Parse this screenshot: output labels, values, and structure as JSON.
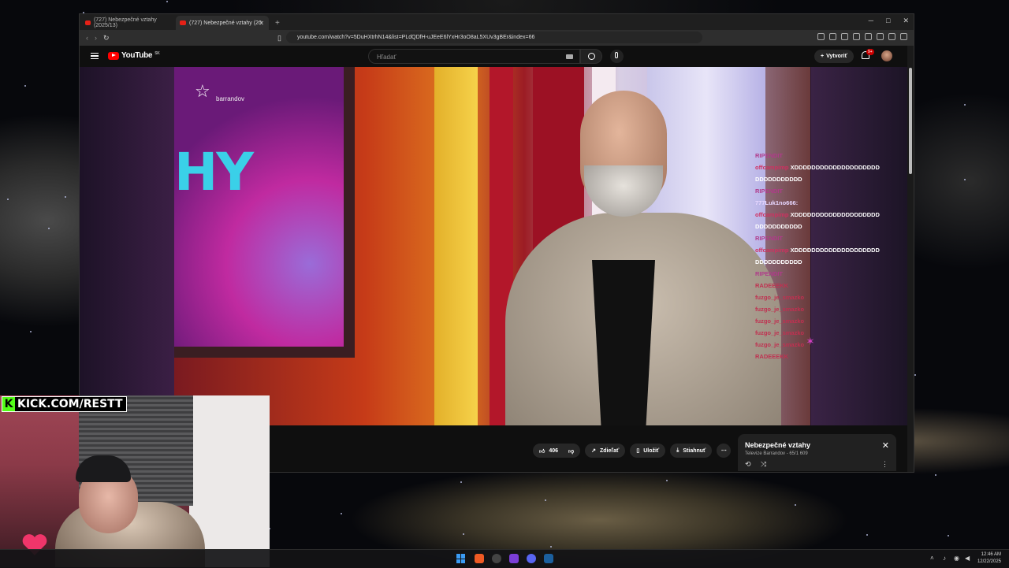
{
  "browser": {
    "tabs": [
      {
        "label": "(727) Nebezpečné vztahy (2025/13)",
        "active": false
      },
      {
        "label": "(727) Nebezpečné vztahy (20",
        "active": true
      }
    ],
    "new_tab": "+",
    "url": "youtube.com/watch?v=5DuHXtrhN14&list=PLdQDfH-uJEeE6lYxHr3oO8aL5XUv3gBEr&index=66"
  },
  "youtube": {
    "logo": "YouTube",
    "region": "SK",
    "search_placeholder": "Hľadať",
    "create_label": "Vytvoriť",
    "notif_count": "9+"
  },
  "video": {
    "brand": "barrandov",
    "graphic_text": "HY"
  },
  "chat": [
    {
      "name": "RIPENDIT",
      "msg": "",
      "color": "#b03a8a"
    },
    {
      "name": "offcampimp",
      "msg": "XDDDDDDDDDDDDDDDDDDDD DDDDDDDDDDD",
      "color": "#d03060"
    },
    {
      "name": "RIPENDIT",
      "msg": "",
      "color": "#b03a8a"
    },
    {
      "name": "777Luk1no666:",
      "msg": "",
      "color": "#e8d7ff"
    },
    {
      "name": "offcampimp",
      "msg": "XDDDDDDDDDDDDDDDDDDDD DDDDDDDDDDD",
      "color": "#d03060"
    },
    {
      "name": "RIPENDIT",
      "msg": "",
      "color": "#b03a8a"
    },
    {
      "name": "offcampimp",
      "msg": "XDDDDDDDDDDDDDDDDDDDD DDDDDDDDDDD",
      "color": "#d03060"
    },
    {
      "name": "RIPENDIT",
      "msg": "",
      "color": "#b03a8a"
    },
    {
      "name": "RADEEEKK",
      "msg": "",
      "color": "#c03050"
    },
    {
      "name": "fuzgo_je_smazko",
      "msg": "",
      "color": "#c03050"
    },
    {
      "name": "fuzgo_je_smazko",
      "msg": "",
      "color": "#c03050"
    },
    {
      "name": "fuzgo_je_smazko",
      "msg": "",
      "color": "#c03050"
    },
    {
      "name": "fuzgo_je_smazko",
      "msg": "",
      "color": "#c03050"
    },
    {
      "name": "fuzgo_je_smazko",
      "msg": "",
      "color": "#c03050"
    },
    {
      "name": "RADEEEKK",
      "msg": "",
      "color": "#c03050"
    }
  ],
  "actions": {
    "likes": "406",
    "share": "Zdieľať",
    "save": "Uložiť",
    "download": "Stiahnuť"
  },
  "playlist": {
    "title": "Nebezpečné vztahy",
    "subtitle": "Televize Barrandov - 65/1 609"
  },
  "overlay": {
    "kick_url": "KICK.COM/RESTT"
  },
  "taskbar": {
    "time": "12:46 AM",
    "date": "12/22/2025"
  }
}
